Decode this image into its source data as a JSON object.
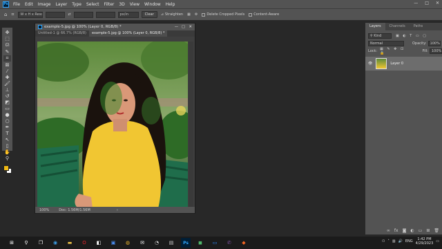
{
  "menubar": {
    "items": [
      "File",
      "Edit",
      "Image",
      "Layer",
      "Type",
      "Select",
      "Filter",
      "3D",
      "View",
      "Window",
      "Help"
    ],
    "window_controls": [
      "—",
      "□",
      "✕"
    ]
  },
  "optionsbar": {
    "ratio": "W x H x Resol...",
    "width": "",
    "height": "",
    "resolution": "",
    "units": "px/in",
    "clear_label": "Clear",
    "straighten_label": "Straighten",
    "delete_cropped_label": "Delete Cropped Pixels",
    "content_aware_label": "Content-Aware"
  },
  "document": {
    "title": "example-5.jpg @ 100% (Layer 0, RGB/8) *",
    "tabs": [
      "Untitled-1 @ 66.7% (RGB/8)",
      "example-5.jpg @ 100% (Layer 0, RGB/8) *"
    ],
    "status_zoom": "100%",
    "status_doc": "Doc: 1.56M/1.56M"
  },
  "layers_panel": {
    "tabs": [
      "Layers",
      "Channels",
      "Paths"
    ],
    "kind_label": "Kind",
    "blend_mode": "Normal",
    "opacity_label": "Opacity:",
    "opacity_value": "100%",
    "lock_label": "Lock:",
    "fill_label": "Fill:",
    "fill_value": "100%",
    "layer_name": "Layer 0"
  },
  "taskbar": {
    "lang": "ENG",
    "time": "1:42 PM",
    "date": "4/29/2023"
  },
  "colors": {
    "foreground": "#f0b913",
    "background": "#ffffff",
    "accent": "#31a8ff"
  }
}
